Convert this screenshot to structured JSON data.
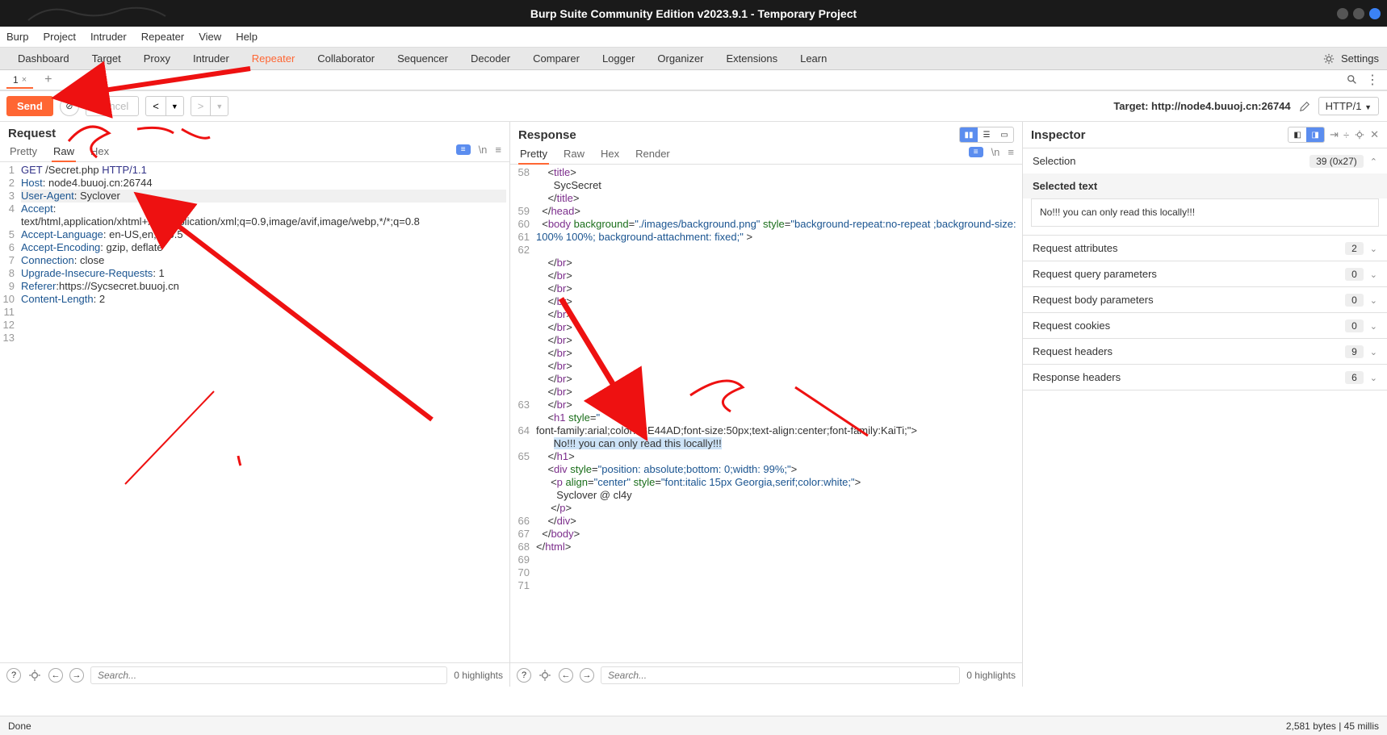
{
  "window": {
    "title": "Burp Suite Community Edition v2023.9.1 - Temporary Project"
  },
  "menubar": [
    "Burp",
    "Project",
    "Intruder",
    "Repeater",
    "View",
    "Help"
  ],
  "tabs": {
    "items": [
      "Dashboard",
      "Target",
      "Proxy",
      "Intruder",
      "Repeater",
      "Collaborator",
      "Sequencer",
      "Decoder",
      "Comparer",
      "Logger",
      "Organizer",
      "Extensions",
      "Learn"
    ],
    "active": "Repeater",
    "settings_label": "Settings"
  },
  "subtabs": {
    "items": [
      {
        "label": "1"
      }
    ]
  },
  "actionbar": {
    "send": "Send",
    "cancel": "Cancel",
    "target_label": "Target: http://node4.buuoj.cn:26744",
    "http_ver": "HTTP/1"
  },
  "request": {
    "title": "Request",
    "tabs": [
      "Pretty",
      "Raw",
      "Hex"
    ],
    "active_tab": "Raw",
    "lines": [
      {
        "n": "1",
        "html": "<span class='tok-method'>GET</span> /Secret.php <span class='tok-method'>HTTP/1.1</span>"
      },
      {
        "n": "2",
        "html": "<span class='tok-header'>Host</span>: node4.buuoj.cn:26744"
      },
      {
        "n": "3",
        "html": "<span class='tok-header'>User-Agent</span>: Syclover",
        "hl": true
      },
      {
        "n": "4",
        "html": "<span class='tok-header'>Accept</span>:\ntext/html,application/xhtml+xml,application/xml;q=0.9,image/avif,image/webp,*/*;q=0.8"
      },
      {
        "n": "5",
        "html": "<span class='tok-header'>Accept-Language</span>: en-US,en;q=0.5"
      },
      {
        "n": "6",
        "html": "<span class='tok-header'>Accept-Encoding</span>: gzip, deflate"
      },
      {
        "n": "7",
        "html": "<span class='tok-header'>Connection</span>: close"
      },
      {
        "n": "8",
        "html": "<span class='tok-header'>Upgrade-Insecure-Requests</span>: 1"
      },
      {
        "n": "9",
        "html": "<span class='tok-header'>Referer</span>:https://Sycsecret.buuoj.cn"
      },
      {
        "n": "10",
        "html": "<span class='tok-header'>Content-Length</span>: 2"
      },
      {
        "n": "11",
        "html": ""
      },
      {
        "n": "12",
        "html": ""
      },
      {
        "n": "13",
        "html": ""
      }
    ],
    "search_placeholder": "Search...",
    "highlights": "0 highlights"
  },
  "response": {
    "title": "Response",
    "tabs": [
      "Pretty",
      "Raw",
      "Hex",
      "Render"
    ],
    "active_tab": "Pretty",
    "lines": [
      {
        "n": "58",
        "html": "    &lt;<span class='tok-tag'>title</span>&gt;"
      },
      {
        "n": "",
        "html": "      SycSecret"
      },
      {
        "n": "",
        "html": "    &lt;/<span class='tok-tag'>title</span>&gt;"
      },
      {
        "n": "59",
        "html": "  &lt;/<span class='tok-tag'>head</span>&gt;"
      },
      {
        "n": "60",
        "html": "  &lt;<span class='tok-tag'>body</span> <span class='tok-attr'>background</span>=<span class='tok-str'>\"./images/background.png\"</span> <span class='tok-attr'>style</span>=<span class='tok-str'>\"background-repeat:no-repeat ;background-size:100% 100%; background-attachment: fixed;\"</span> &gt;"
      },
      {
        "n": "61",
        "html": ""
      },
      {
        "n": "62",
        "html": "    &lt;/<span class='tok-tag'>br</span>&gt;"
      },
      {
        "n": "",
        "html": "    &lt;/<span class='tok-tag'>br</span>&gt;"
      },
      {
        "n": "",
        "html": "    &lt;/<span class='tok-tag'>br</span>&gt;"
      },
      {
        "n": "",
        "html": "    &lt;/<span class='tok-tag'>br</span>&gt;"
      },
      {
        "n": "",
        "html": "    &lt;/<span class='tok-tag'>br</span>&gt;"
      },
      {
        "n": "",
        "html": "    &lt;/<span class='tok-tag'>br</span>&gt;"
      },
      {
        "n": "",
        "html": "    &lt;/<span class='tok-tag'>br</span>&gt;"
      },
      {
        "n": "",
        "html": "    &lt;/<span class='tok-tag'>br</span>&gt;"
      },
      {
        "n": "",
        "html": "    &lt;/<span class='tok-tag'>br</span>&gt;"
      },
      {
        "n": "",
        "html": "    &lt;/<span class='tok-tag'>br</span>&gt;"
      },
      {
        "n": "",
        "html": "    &lt;/<span class='tok-tag'>br</span>&gt;"
      },
      {
        "n": "",
        "html": "    &lt;/<span class='tok-tag'>br</span>&gt;"
      },
      {
        "n": "63",
        "html": "    &lt;<span class='tok-tag'>h1</span> <span class='tok-attr'>style</span>=<span class='tok-str'>\"\nfont-family:arial;color:#8E44AD;font-size:50px;text-align:center;font-family:KaiTi;\"</span>&gt;"
      },
      {
        "n": "64",
        "html": "      <span class='selected-text'>No!!! you can only read this locally!!!</span>"
      },
      {
        "n": "",
        "html": "    &lt;/<span class='tok-tag'>h1</span>&gt;"
      },
      {
        "n": "65",
        "html": "    &lt;<span class='tok-tag'>div</span> <span class='tok-attr'>style</span>=<span class='tok-str'>\"position: absolute;bottom: 0;width: 99%;\"</span>&gt;"
      },
      {
        "n": "",
        "html": "     &lt;<span class='tok-tag'>p</span> <span class='tok-attr'>align</span>=<span class='tok-str'>\"center\"</span> <span class='tok-attr'>style</span>=<span class='tok-str'>\"font:italic 15px Georgia,serif;color:white;\"</span>&gt;"
      },
      {
        "n": "",
        "html": "       Syclover @ cl4y"
      },
      {
        "n": "",
        "html": "     &lt;/<span class='tok-tag'>p</span>&gt;"
      },
      {
        "n": "",
        "html": "    &lt;/<span class='tok-tag'>div</span>&gt;"
      },
      {
        "n": "66",
        "html": "  &lt;/<span class='tok-tag'>body</span>&gt;"
      },
      {
        "n": "67",
        "html": "&lt;/<span class='tok-tag'>html</span>&gt;"
      },
      {
        "n": "68",
        "html": ""
      },
      {
        "n": "69",
        "html": ""
      },
      {
        "n": "70",
        "html": ""
      },
      {
        "n": "71",
        "html": ""
      }
    ],
    "search_placeholder": "Search...",
    "highlights": "0 highlights"
  },
  "inspector": {
    "title": "Inspector",
    "selection": {
      "label": "Selection",
      "count": "39 (0x27)"
    },
    "selected_text_label": "Selected text",
    "selected_text": "No!!! you can only read this locally!!!",
    "sections": [
      {
        "label": "Request attributes",
        "count": "2"
      },
      {
        "label": "Request query parameters",
        "count": "0"
      },
      {
        "label": "Request body parameters",
        "count": "0"
      },
      {
        "label": "Request cookies",
        "count": "0"
      },
      {
        "label": "Request headers",
        "count": "9"
      },
      {
        "label": "Response headers",
        "count": "6"
      }
    ]
  },
  "status": {
    "left": "Done",
    "right": "2,581 bytes | 45 millis"
  }
}
